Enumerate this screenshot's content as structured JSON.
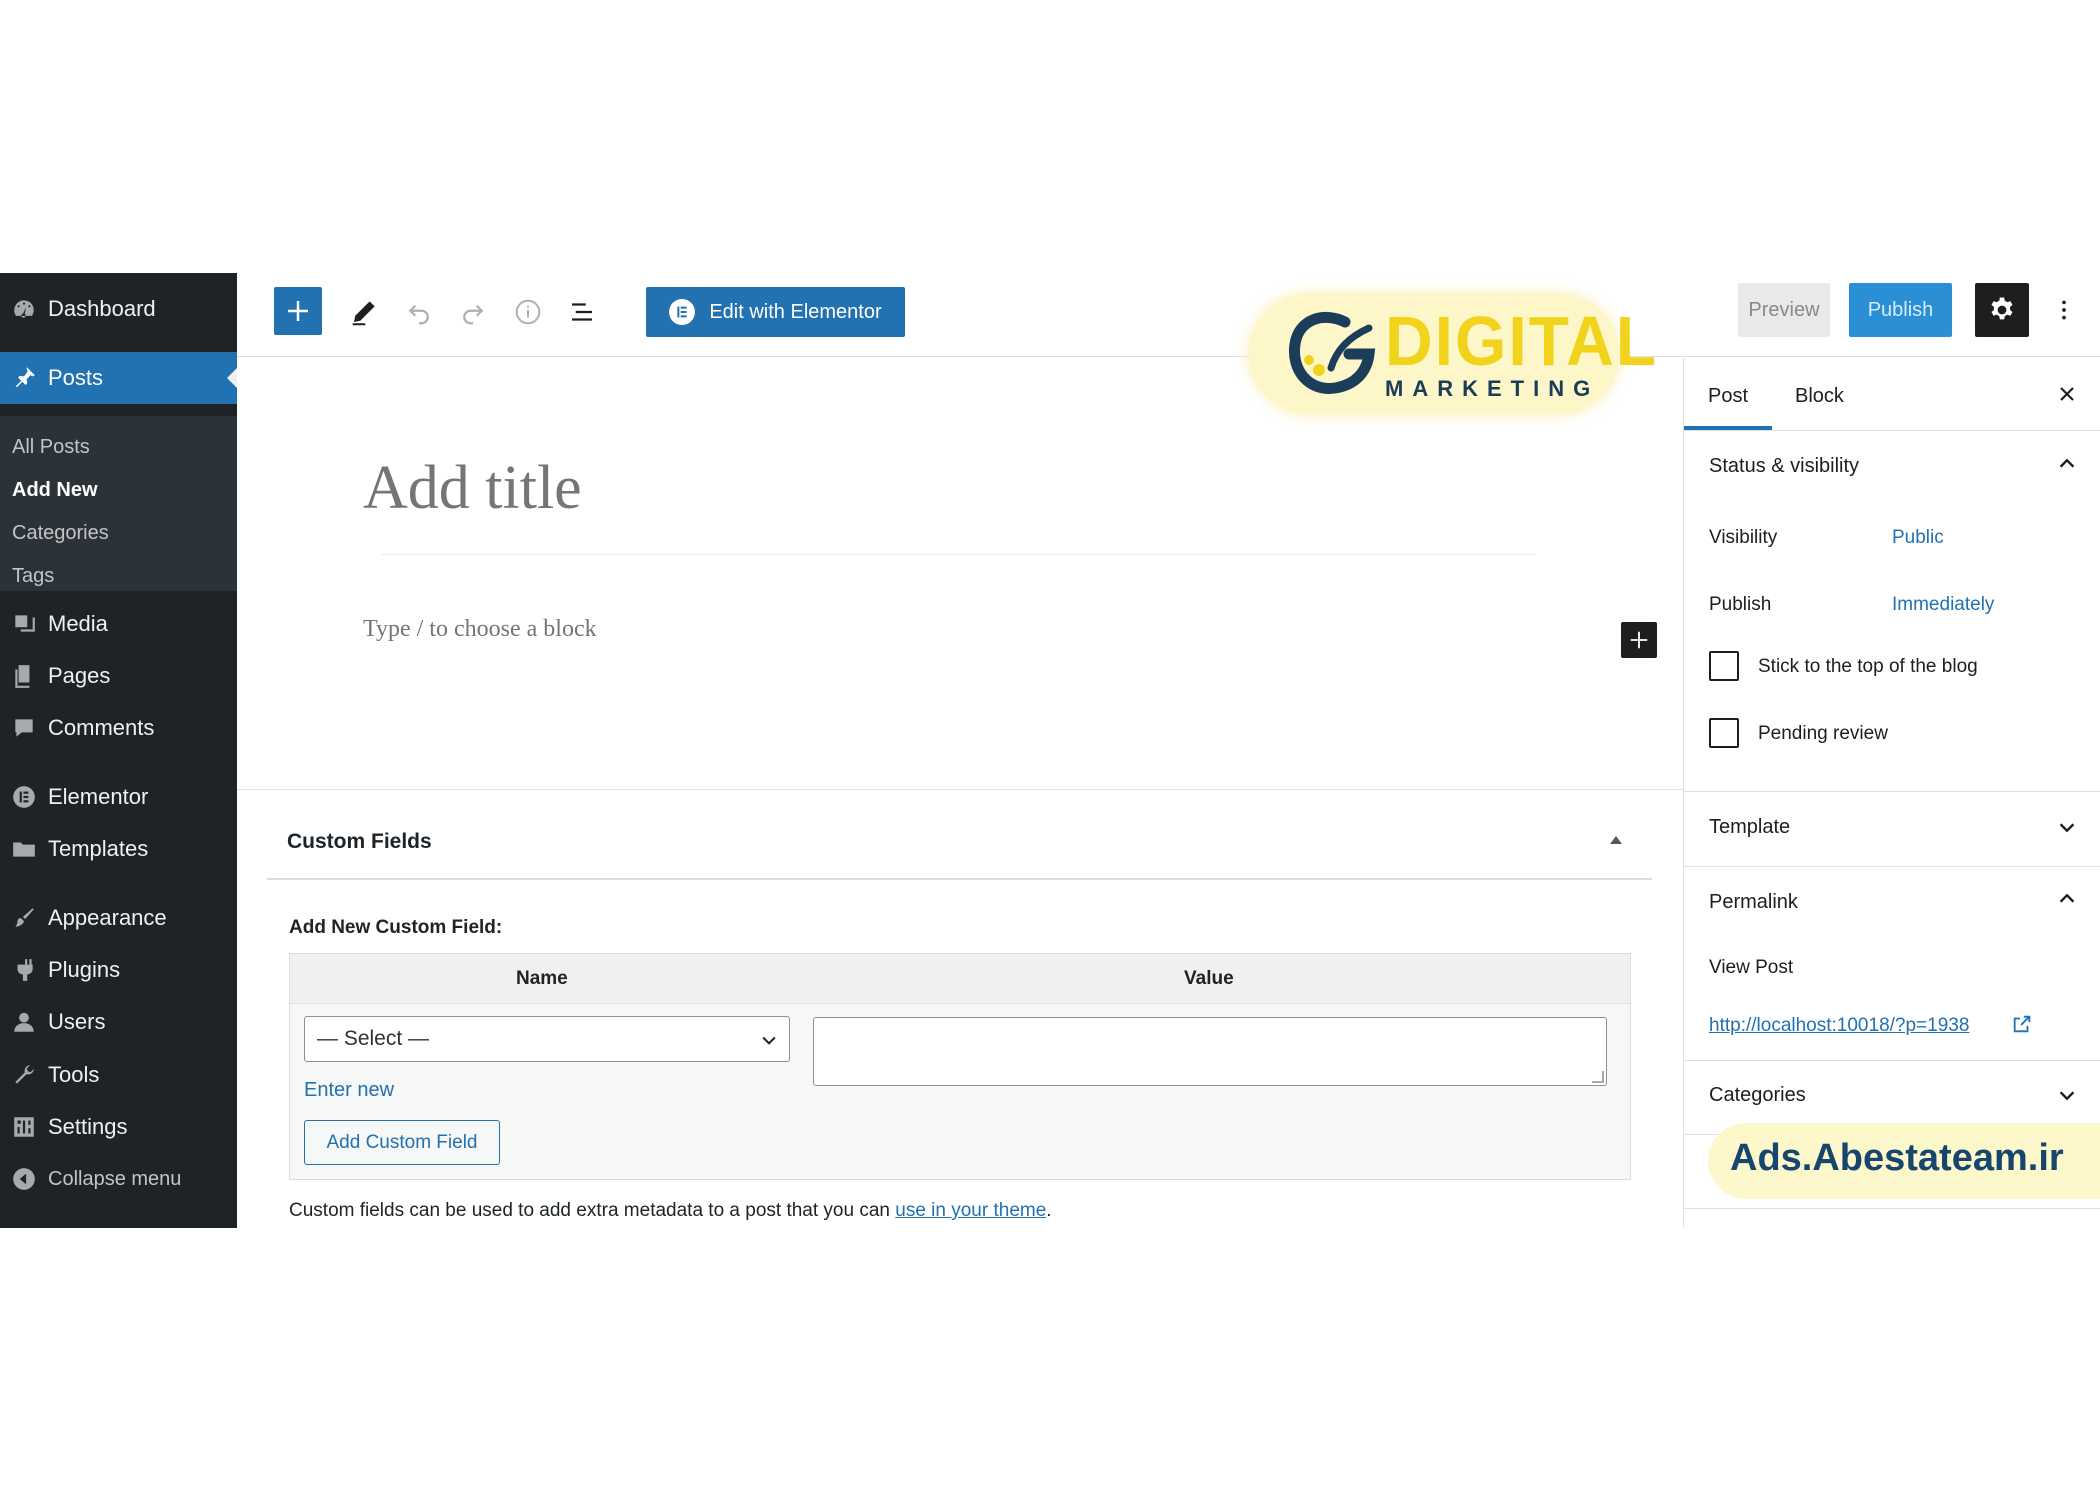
{
  "sidebar": {
    "menu": {
      "dashboard": "Dashboard",
      "posts": "Posts",
      "media": "Media",
      "pages": "Pages",
      "comments": "Comments",
      "elementor": "Elementor",
      "templates": "Templates",
      "appearance": "Appearance",
      "plugins": "Plugins",
      "users": "Users",
      "tools": "Tools",
      "settings": "Settings",
      "collapse": "Collapse menu"
    },
    "posts_submenu": {
      "all_posts": "All Posts",
      "add_new": "Add New",
      "categories": "Categories",
      "tags": "Tags"
    }
  },
  "toolbar": {
    "elementor_label": "Edit with Elementor",
    "preview_label": "Preview",
    "publish_label": "Publish"
  },
  "editor": {
    "title_placeholder": "Add title",
    "block_placeholder": "Type / to choose a block"
  },
  "custom_fields": {
    "title": "Custom Fields",
    "subtitle": "Add New Custom Field:",
    "col_name": "Name",
    "col_value": "Value",
    "select_value": "— Select —",
    "enter_new": "Enter new",
    "add_button": "Add Custom Field",
    "note_text": "Custom fields can be used to add extra metadata to a post that you can ",
    "note_link": "use in your theme",
    "note_end": "."
  },
  "settings_panel": {
    "tabs": {
      "post": "Post",
      "block": "Block"
    },
    "status": {
      "title": "Status & visibility",
      "visibility_label": "Visibility",
      "visibility_value": "Public",
      "publish_label": "Publish",
      "publish_value": "Immediately",
      "sticky_label": "Stick to the top of the blog",
      "sticky_checked": false,
      "pending_label": "Pending review",
      "pending_checked": false
    },
    "template": {
      "title": "Template"
    },
    "permalink": {
      "title": "Permalink",
      "view_post_label": "View Post",
      "url": "http://localhost:10018/?p=1938"
    },
    "categories": {
      "title": "Categories"
    }
  },
  "overlays": {
    "logo_word1": "DIGITAL",
    "logo_word2": "MARKETING",
    "watermark": "Ads.Abestateam.ir"
  },
  "colors": {
    "wp_blue": "#2271b1",
    "admin_dark": "#1d2327",
    "logo_yellow": "#f2d31c",
    "logo_navy": "#1c3d5a"
  },
  "icons": {
    "inserter": "plus-icon",
    "tools": "pencil-icon",
    "undo": "undo-icon",
    "redo": "redo-icon",
    "details": "info-icon",
    "outline": "list-view-icon",
    "settings": "gear-icon",
    "more": "vertical-ellipsis-icon"
  }
}
